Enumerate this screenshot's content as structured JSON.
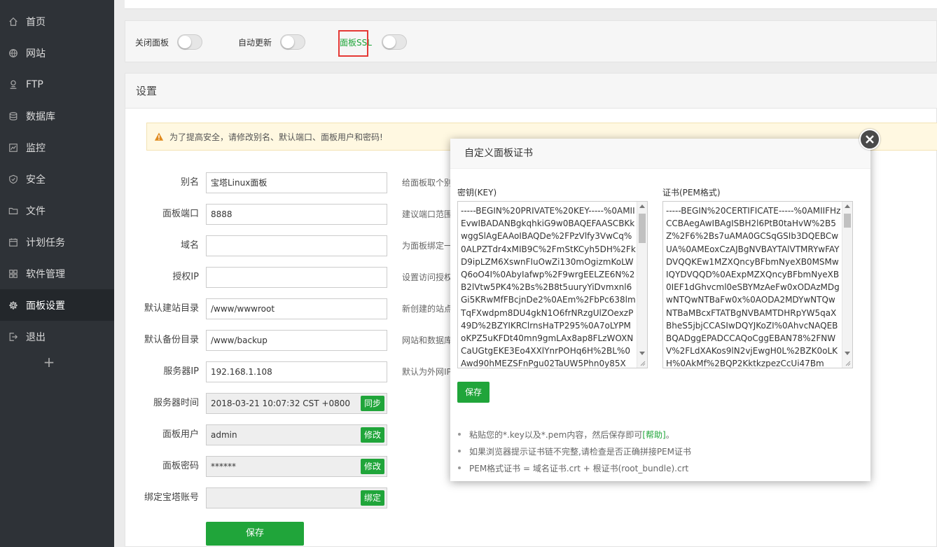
{
  "sidebar": {
    "items": [
      {
        "label": "首页",
        "icon": "home-icon"
      },
      {
        "label": "网站",
        "icon": "globe-icon"
      },
      {
        "label": "FTP",
        "icon": "ftp-icon"
      },
      {
        "label": "数据库",
        "icon": "database-icon"
      },
      {
        "label": "监控",
        "icon": "monitor-icon"
      },
      {
        "label": "安全",
        "icon": "shield-icon"
      },
      {
        "label": "文件",
        "icon": "folder-icon"
      },
      {
        "label": "计划任务",
        "icon": "calendar-icon"
      },
      {
        "label": "软件管理",
        "icon": "apps-icon"
      },
      {
        "label": "面板设置",
        "icon": "gear-icon",
        "active": true
      },
      {
        "label": "退出",
        "icon": "logout-icon"
      }
    ],
    "add_label": "+"
  },
  "toggles": {
    "close_panel": "关闭面板",
    "auto_update": "自动更新",
    "panel_ssl": "面板SSL"
  },
  "settings": {
    "title": "设置",
    "warning": "为了提高安全，请修改别名、默认端口、面板用户和密码!",
    "fields": {
      "alias": {
        "label": "别名",
        "value": "宝塔Linux面板",
        "hint": "给面板取个别"
      },
      "port": {
        "label": "面板端口",
        "value": "8888",
        "hint": "建议端口范围"
      },
      "domain": {
        "label": "域名",
        "value": "",
        "hint": "为面板绑定一"
      },
      "auth_ip": {
        "label": "授权IP",
        "value": "",
        "hint": "设置访问授权"
      },
      "site_dir": {
        "label": "默认建站目录",
        "value": "/www/wwwroot",
        "hint": "新创建的站点"
      },
      "backup_dir": {
        "label": "默认备份目录",
        "value": "/www/backup",
        "hint": "网站和数据库"
      },
      "server_ip": {
        "label": "服务器IP",
        "value": "192.168.1.108",
        "hint": "默认为外网IP"
      },
      "server_time": {
        "label": "服务器时间",
        "value": "2018-03-21 10:07:32 CST +0800",
        "button": "同步"
      },
      "panel_user": {
        "label": "面板用户",
        "value": "admin",
        "button": "修改"
      },
      "panel_password": {
        "label": "面板密码",
        "value": "******",
        "button": "修改"
      },
      "bind_account": {
        "label": "绑定宝塔账号",
        "value": "",
        "button": "绑定"
      }
    },
    "save_label": "保存"
  },
  "modal": {
    "title": "自定义面板证书",
    "key_label": "密钥(KEY)",
    "key_text": "-----BEGIN%20PRIVATE%20KEY-----%0AMIIEvwIBADANBgkqhkiG9w0BAQEFAASCBKkwggSlAgEAAoIBAQDe%2FPzVlfy3VwCq%0ALPZTdr4xMIB9C%2FmStKCyh5DH%2FkD9ipLZM6XswnFIuOwZi130mOgizmKoLWQ6oO4I%0AbyIafwp%2F9wrgEELZE6N%2B2lVtw5PK4%2Bs%2B8t5uuryYiDvmxnl6Gi5KRwMfFBcjnDe2%0AEm%2FbPc638lmTqFXwdpm8DU4gkN1O6frNRzgUlZOexzP49D%2BZYIKRClrnsHaTP295%0A7oLYPMoKPZ5uKFDt40mn9gmLAx8ap8FLzWOXNCaUGtgEKE3Eo4XXlYnrPOHq6H%2BL%0Awd90hMEZSFnPgu02TaUW5Phn0y85X",
    "cert_label": "证书(PEM格式)",
    "cert_text": "-----BEGIN%20CERTIFICATE-----%0AMIIFHzCCBAegAwIBAgISBH2l6PtB0taHvW%2B5Z%2F6%2Bs7uAMA0GCSqGSIb3DQEBCwUA%0AMEoxCzAJBgNVBAYTAlVTMRYwFAYDVQQKEw1MZXQncyBFbmNyeXB0MSMwIQYDVQQD%0AExpMZXQncyBFbmNyeXB0IEF1dGhvcml0eSBYMzAeFw0xODAzMDgwNTQwNTBaFw0x%0AODA2MDYwNTQwNTBaMBcxFTATBgNVBAMTDHRpYW5qaXBheS5jbjCCASIwDQYJKoZI%0AhvcNAQEBBQADggEPADCCAQoCggEBAN78%2FNWV%2FLdXAKos9lN2vjEwgH0L%2BZK0oLKH%0AkMf%2BQP2KktkzpezCcUi47Bm",
    "save_label": "保存",
    "tips": {
      "tip1_before": "粘贴您的*.key以及*.pem内容，然后保存即可",
      "tip1_link": "[帮助]",
      "tip1_after": "。",
      "tip2": "如果浏览器提示证书链不完整,请检查是否正确拼接PEM证书",
      "tip3": "PEM格式证书 = 域名证书.crt + 根证书(root_bundle).crt"
    }
  },
  "colors": {
    "sidebar_bg": "#2e3237",
    "accent_green": "#20a53a",
    "highlight_red": "#e53935"
  }
}
